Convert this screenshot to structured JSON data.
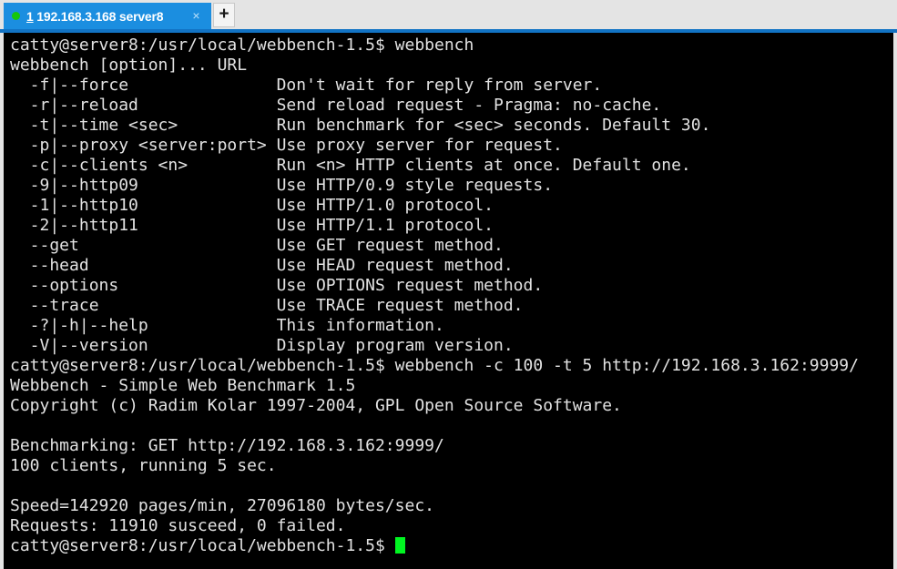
{
  "window": {
    "chrome_bg": "#e4e4e4",
    "accent": "#1273c4"
  },
  "tabbar": {
    "active_tab": {
      "status_icon": "green-dot-icon",
      "status_color": "#16c60c",
      "number": "1",
      "title": "192.168.3.168 server8",
      "close_icon": "×"
    },
    "new_tab_label": "+"
  },
  "terminal": {
    "bg_color": "#000000",
    "fg_color": "#e2e2e2",
    "cursor_color": "#00f521",
    "prompt": "catty@server8:/usr/local/webbench-1.5$",
    "commands": [
      "webbench",
      "webbench -c 100 -t 5 http://192.168.3.162:9999/"
    ],
    "help": {
      "usage": "webbench [option]... URL",
      "options": [
        {
          "flag": "-f|--force",
          "desc": "Don't wait for reply from server."
        },
        {
          "flag": "-r|--reload",
          "desc": "Send reload request - Pragma: no-cache."
        },
        {
          "flag": "-t|--time <sec>",
          "desc": "Run benchmark for <sec> seconds. Default 30."
        },
        {
          "flag": "-p|--proxy <server:port>",
          "desc": "Use proxy server for request."
        },
        {
          "flag": "-c|--clients <n>",
          "desc": "Run <n> HTTP clients at once. Default one."
        },
        {
          "flag": "-9|--http09",
          "desc": "Use HTTP/0.9 style requests."
        },
        {
          "flag": "-1|--http10",
          "desc": "Use HTTP/1.0 protocol."
        },
        {
          "flag": "-2|--http11",
          "desc": "Use HTTP/1.1 protocol."
        },
        {
          "flag": "--get",
          "desc": "Use GET request method."
        },
        {
          "flag": "--head",
          "desc": "Use HEAD request method."
        },
        {
          "flag": "--options",
          "desc": "Use OPTIONS request method."
        },
        {
          "flag": "--trace",
          "desc": "Use TRACE request method."
        },
        {
          "flag": "-?|-h|--help",
          "desc": "This information."
        },
        {
          "flag": "-V|--version",
          "desc": "Display program version."
        }
      ]
    },
    "run_output": {
      "banner": "Webbench - Simple Web Benchmark 1.5",
      "copyright": "Copyright (c) Radim Kolar 1997-2004, GPL Open Source Software.",
      "benchmarking": "Benchmarking: GET http://192.168.3.162:9999/",
      "clients_line": "100 clients, running 5 sec.",
      "speed_line": "Speed=142920 pages/min, 27096180 bytes/sec.",
      "requests_line": "Requests: 11910 susceed, 0 failed.",
      "speed_pages_per_min": 142920,
      "speed_bytes_per_sec": 27096180,
      "requests_succeed": 11910,
      "requests_failed": 0,
      "clients": 100,
      "duration_sec": 5,
      "target_url": "http://192.168.3.162:9999/"
    }
  }
}
